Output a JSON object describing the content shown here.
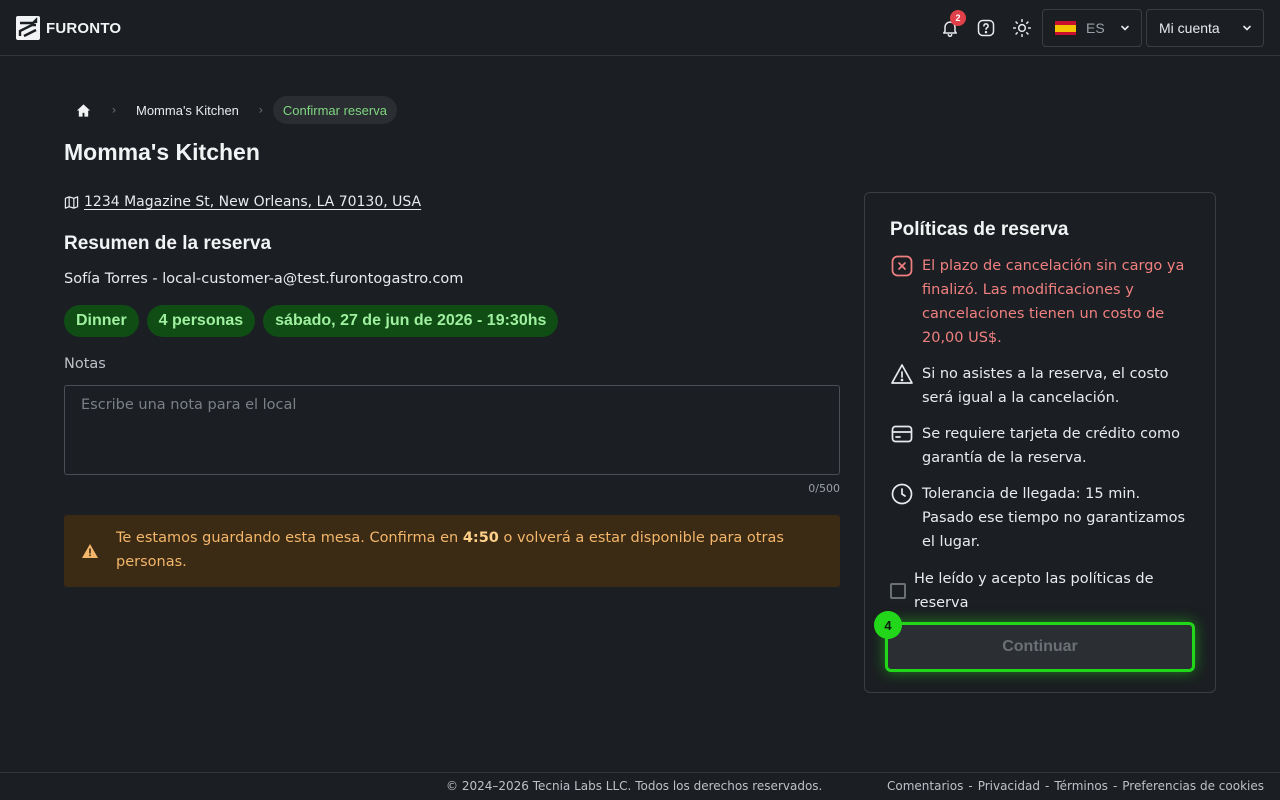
{
  "header": {
    "logo_text": "FURONTO",
    "notifications_count": "2",
    "language_code": "ES",
    "account_label": "Mi cuenta"
  },
  "breadcrumb": {
    "items": [
      "Momma's Kitchen"
    ],
    "current": "Confirmar reserva"
  },
  "page": {
    "title": "Momma's Kitchen",
    "address": "1234 Magazine St, New Orleans, LA 70130, USA"
  },
  "summary": {
    "title": "Resumen de la reserva",
    "customer": "Sofía Torres - local-customer-a@test.furontogastro.com",
    "chips": [
      "Dinner",
      "4 personas",
      "sábado, 27 de jun de 2026 - 19:30hs"
    ]
  },
  "notes": {
    "label": "Notas",
    "placeholder": "Escribe una nota para el local",
    "counter": "0/500"
  },
  "alert": {
    "text_before": "Te estamos guardando esta mesa. Confirma en ",
    "countdown": "4:50",
    "text_after": " o volverá a estar disponible para otras personas."
  },
  "policies": {
    "title": "Políticas de reserva",
    "items": [
      {
        "icon": "x-circle-icon",
        "text": "El plazo de cancelación sin cargo ya finalizó. Las modificaciones y cancelaciones tienen un costo de 20,00 US$."
      },
      {
        "icon": "warning-icon",
        "text": "Si no asistes a la reserva, el costo será igual a la cancelación."
      },
      {
        "icon": "credit-card-icon",
        "text": "Se requiere tarjeta de crédito como garantía de la reserva."
      },
      {
        "icon": "clock-icon",
        "text": "Tolerancia de llegada: 15 min. Pasado ese tiempo no garantizamos el lugar."
      }
    ],
    "accept_label": "He leído y acepto las políticas de reserva",
    "continue_label": "Continuar",
    "step_badge": "4"
  },
  "footer": {
    "copyright": "© 2024–2026 Tecnia Labs LLC. Todos los derechos reservados.",
    "links": [
      "Comentarios",
      "Privacidad",
      "Términos",
      "Preferencias de cookies"
    ]
  },
  "colors": {
    "background": "#1b1e22",
    "accent_green": "#22d61a",
    "chip_bg": "#0f4d15",
    "danger": "#f08080",
    "alert_bg": "#3b2a14",
    "alert_text": "#f3b66a"
  }
}
